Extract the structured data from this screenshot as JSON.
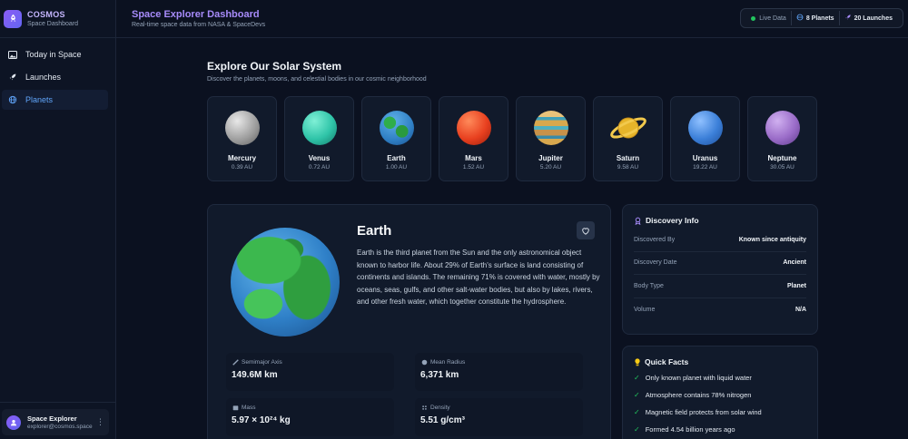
{
  "brand": {
    "name": "COSMOS",
    "subtitle": "Space Dashboard"
  },
  "nav": [
    {
      "label": "Today in Space",
      "icon": "image-icon",
      "active": false
    },
    {
      "label": "Launches",
      "icon": "rocket-icon",
      "active": false
    },
    {
      "label": "Planets",
      "icon": "globe-icon",
      "active": true
    }
  ],
  "user": {
    "name": "Space Explorer",
    "email": "explorer@cosmos.space"
  },
  "header": {
    "title": "Space Explorer Dashboard",
    "subtitle": "Real-time space data from NASA & SpaceDevs",
    "live": "Live Data",
    "planets": "8 Planets",
    "launches": "20 Launches"
  },
  "section": {
    "title": "Explore Our Solar System",
    "subtitle": "Discover the planets, moons, and celestial bodies in our cosmic neighborhood"
  },
  "planets": [
    {
      "name": "Mercury",
      "distance": "0.39 AU",
      "color": "#b8b8b8"
    },
    {
      "name": "Venus",
      "distance": "0.72 AU",
      "color": "#2fc4a8"
    },
    {
      "name": "Earth",
      "distance": "1.00 AU",
      "color": "#3b82c4"
    },
    {
      "name": "Mars",
      "distance": "1.52 AU",
      "color": "#e8401f"
    },
    {
      "name": "Jupiter",
      "distance": "5.20 AU",
      "color": "#d8a84e"
    },
    {
      "name": "Saturn",
      "distance": "9.58 AU",
      "color": "#e6b42a"
    },
    {
      "name": "Uranus",
      "distance": "19.22 AU",
      "color": "#3b7fd8"
    },
    {
      "name": "Neptune",
      "distance": "30.05 AU",
      "color": "#9a6cc8"
    }
  ],
  "detail": {
    "name": "Earth",
    "description": "Earth is the third planet from the Sun and the only astronomical object known to harbor life. About 29% of Earth's surface is land consisting of continents and islands. The remaining 71% is covered with water, mostly by oceans, seas, gulfs, and other salt-water bodies, but also by lakes, rivers, and other fresh water, which together constitute the hydrosphere.",
    "stats": [
      {
        "label": "Semimajor Axis",
        "value": "149.6M km",
        "icon": "ruler-icon"
      },
      {
        "label": "Mean Radius",
        "value": "6,371 km",
        "icon": "circle-icon"
      },
      {
        "label": "Mass",
        "value": "5.97 × 10²⁴ kg",
        "icon": "weight-icon"
      },
      {
        "label": "Density",
        "value": "5.51 g/cm³",
        "icon": "density-icon"
      }
    ]
  },
  "discovery": {
    "title": "Discovery Info",
    "rows": [
      {
        "key": "Discovered By",
        "value": "Known since antiquity"
      },
      {
        "key": "Discovery Date",
        "value": "Ancient"
      },
      {
        "key": "Body Type",
        "value": "Planet"
      },
      {
        "key": "Volume",
        "value": "N/A"
      }
    ]
  },
  "facts": {
    "title": "Quick Facts",
    "items": [
      "Only known planet with liquid water",
      "Atmosphere contains 78% nitrogen",
      "Magnetic field protects from solar wind",
      "Formed 4.54 billion years ago"
    ]
  }
}
